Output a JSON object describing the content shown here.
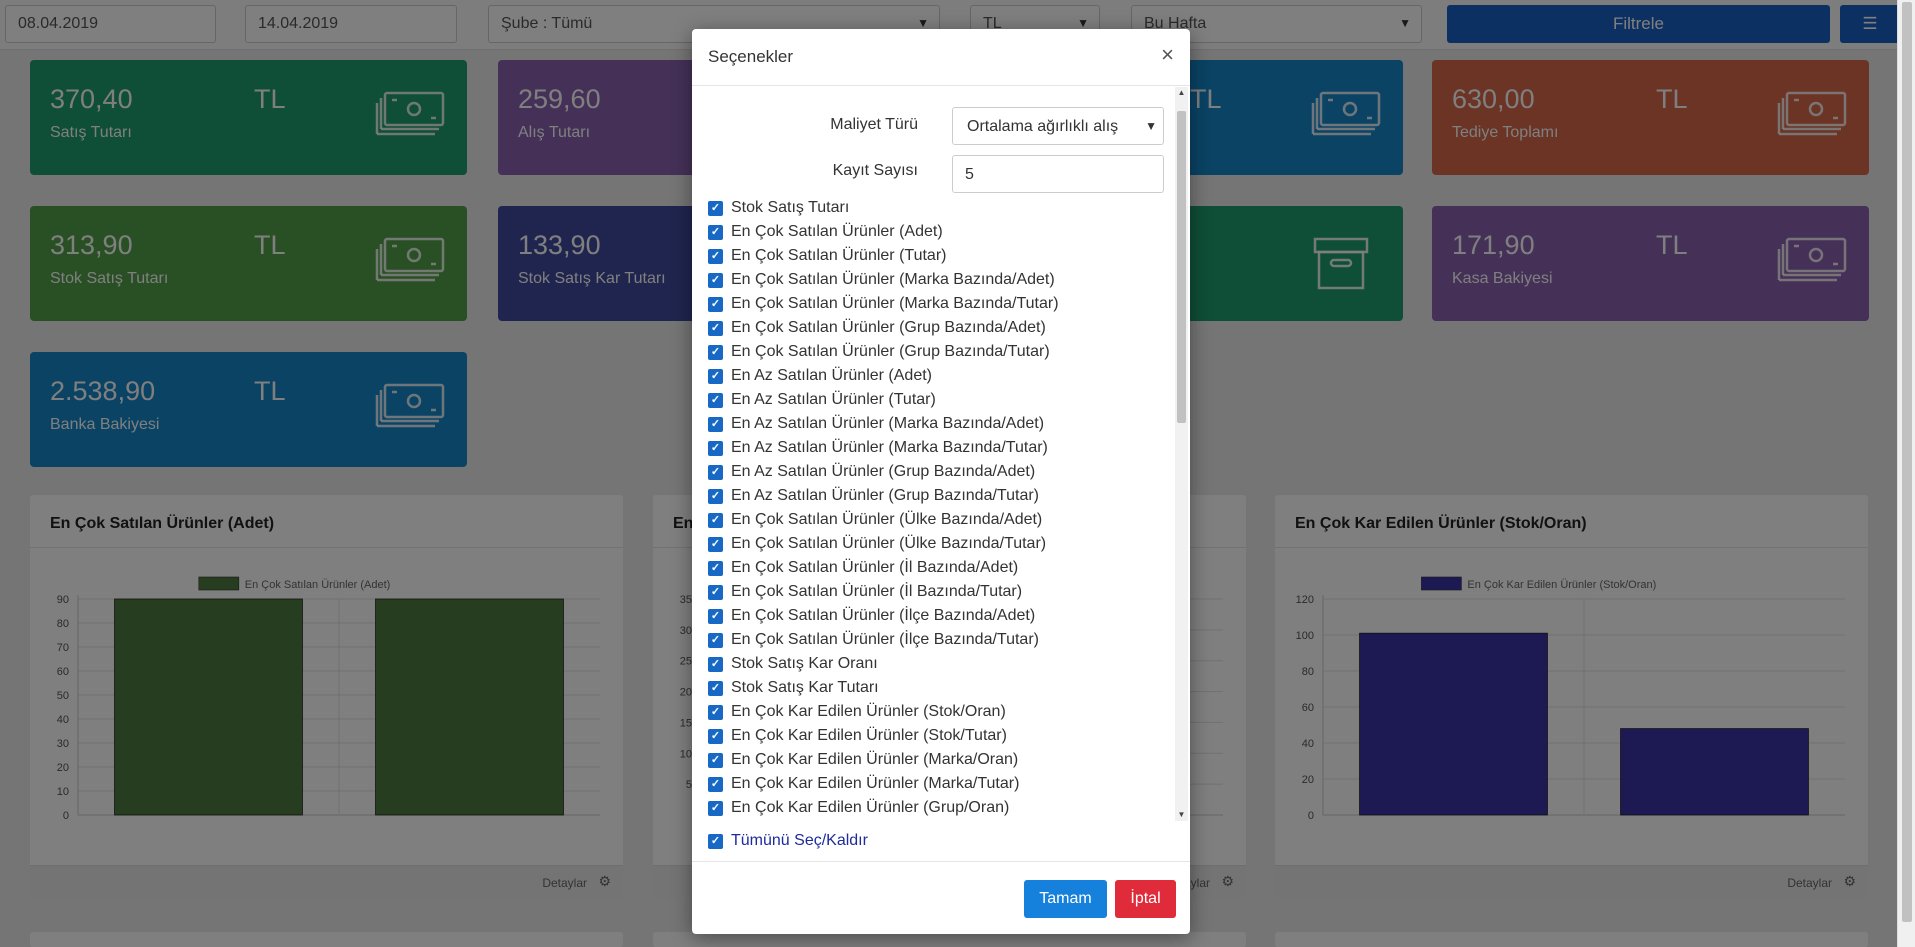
{
  "filters": {
    "start_date": "08.04.2019",
    "end_date": "14.04.2019",
    "branch": "Şube : Tümü",
    "currency": "TL",
    "period": "Bu Hafta",
    "filter_button": "Filtrele"
  },
  "cards": [
    {
      "amount": "370,40",
      "currency": "TL",
      "label": "Satış Tutarı",
      "color": "#1e9c6e",
      "icon": "money-icon"
    },
    {
      "amount": "259,60",
      "currency": "TL",
      "label": "Alış Tutarı",
      "color": "#8a62b1",
      "icon": "money-icon"
    },
    {
      "amount": "",
      "currency": "TL",
      "label": "",
      "color": "#1586c9",
      "icon": "money-icon"
    },
    {
      "amount": "630,00",
      "currency": "TL",
      "label": "Tediye Toplamı",
      "color": "#d6684a",
      "icon": "money-icon"
    },
    {
      "amount": "313,90",
      "currency": "TL",
      "label": "Stok Satış Tutarı",
      "color": "#52a04a",
      "icon": "money-icon"
    },
    {
      "amount": "133,90",
      "currency": "TL",
      "label": "Stok Satış Kar Tutarı",
      "color": "#404a9e",
      "icon": "money-icon"
    },
    {
      "amount": "",
      "currency": "",
      "label": "",
      "color": "#1e9c6e",
      "icon": "archive-icon"
    },
    {
      "amount": "171,90",
      "currency": "TL",
      "label": "Kasa Bakiyesi",
      "color": "#8a62b1",
      "icon": "money-icon"
    },
    {
      "amount": "2.538,90",
      "currency": "TL",
      "label": "Banka Bakiyesi",
      "color": "#1586c9",
      "icon": "money-icon"
    }
  ],
  "panels": [
    {
      "title": "En Çok Satılan Ürünler (Adet)",
      "footer": "Detaylar"
    },
    {
      "title": "En",
      "footer": "Detaylar"
    },
    {
      "title": "En Çok Kar Edilen Ürünler (Stok/Oran)",
      "footer": "Detaylar"
    }
  ],
  "chart_data": [
    {
      "type": "bar",
      "title": "",
      "legend": "En Çok Satılan Ürünler (Adet)",
      "legend_position": "top",
      "categories": [
        "",
        ""
      ],
      "series": [
        {
          "name": "En Çok Satılan Ürünler (Adet)",
          "values": [
            90,
            90
          ]
        }
      ],
      "yticks": [
        0,
        10,
        20,
        30,
        40,
        50,
        60,
        70,
        80,
        90
      ],
      "ylim": [
        0,
        90
      ],
      "color": "#4e7a3f",
      "grid": true
    },
    {
      "type": "bar",
      "title": "",
      "legend": "",
      "categories": [],
      "series": [],
      "yticks": [
        5,
        10,
        15,
        20,
        25,
        30,
        35
      ],
      "ylim": [
        0,
        35
      ],
      "grid": true
    },
    {
      "type": "bar",
      "title": "",
      "legend": "En Çok Kar Edilen Ürünler (Stok/Oran)",
      "legend_position": "top",
      "categories": [
        "",
        ""
      ],
      "series": [
        {
          "name": "En Çok Kar Edilen Ürünler (Stok/Oran)",
          "values": [
            101,
            48
          ]
        }
      ],
      "yticks": [
        0,
        20,
        40,
        60,
        80,
        100,
        120
      ],
      "ylim": [
        0,
        120
      ],
      "color": "#3b33a6",
      "grid": true
    }
  ],
  "modal": {
    "title": "Seçenekler",
    "close": "×",
    "cost_type_label": "Maliyet Türü",
    "cost_type_value": "Ortalama ağırlıklı alış",
    "record_count_label": "Kayıt Sayısı",
    "record_count_value": "5",
    "options": [
      "Stok Satış Tutarı",
      "En Çok Satılan Ürünler (Adet)",
      "En Çok Satılan Ürünler (Tutar)",
      "En Çok Satılan Ürünler (Marka Bazında/Adet)",
      "En Çok Satılan Ürünler (Marka Bazında/Tutar)",
      "En Çok Satılan Ürünler (Grup Bazında/Adet)",
      "En Çok Satılan Ürünler (Grup Bazında/Tutar)",
      "En Az Satılan Ürünler (Adet)",
      "En Az Satılan Ürünler (Tutar)",
      "En Az Satılan Ürünler (Marka Bazında/Adet)",
      "En Az Satılan Ürünler (Marka Bazında/Tutar)",
      "En Az Satılan Ürünler (Grup Bazında/Adet)",
      "En Az Satılan Ürünler (Grup Bazında/Tutar)",
      "En Çok Satılan Ürünler (Ülke Bazında/Adet)",
      "En Çok Satılan Ürünler (Ülke Bazında/Tutar)",
      "En Çok Satılan Ürünler (İl Bazında/Adet)",
      "En Çok Satılan Ürünler (İl Bazında/Tutar)",
      "En Çok Satılan Ürünler (İlçe Bazında/Adet)",
      "En Çok Satılan Ürünler (İlçe Bazında/Tutar)",
      "Stok Satış Kar Oranı",
      "Stok Satış Kar Tutarı",
      "En Çok Kar Edilen Ürünler (Stok/Oran)",
      "En Çok Kar Edilen Ürünler (Stok/Tutar)",
      "En Çok Kar Edilen Ürünler (Marka/Oran)",
      "En Çok Kar Edilen Ürünler (Marka/Tutar)",
      "En Çok Kar Edilen Ürünler (Grup/Oran)"
    ],
    "select_all": "Tümünü Seç/Kaldır",
    "ok_button": "Tamam",
    "cancel_button": "İptal"
  }
}
